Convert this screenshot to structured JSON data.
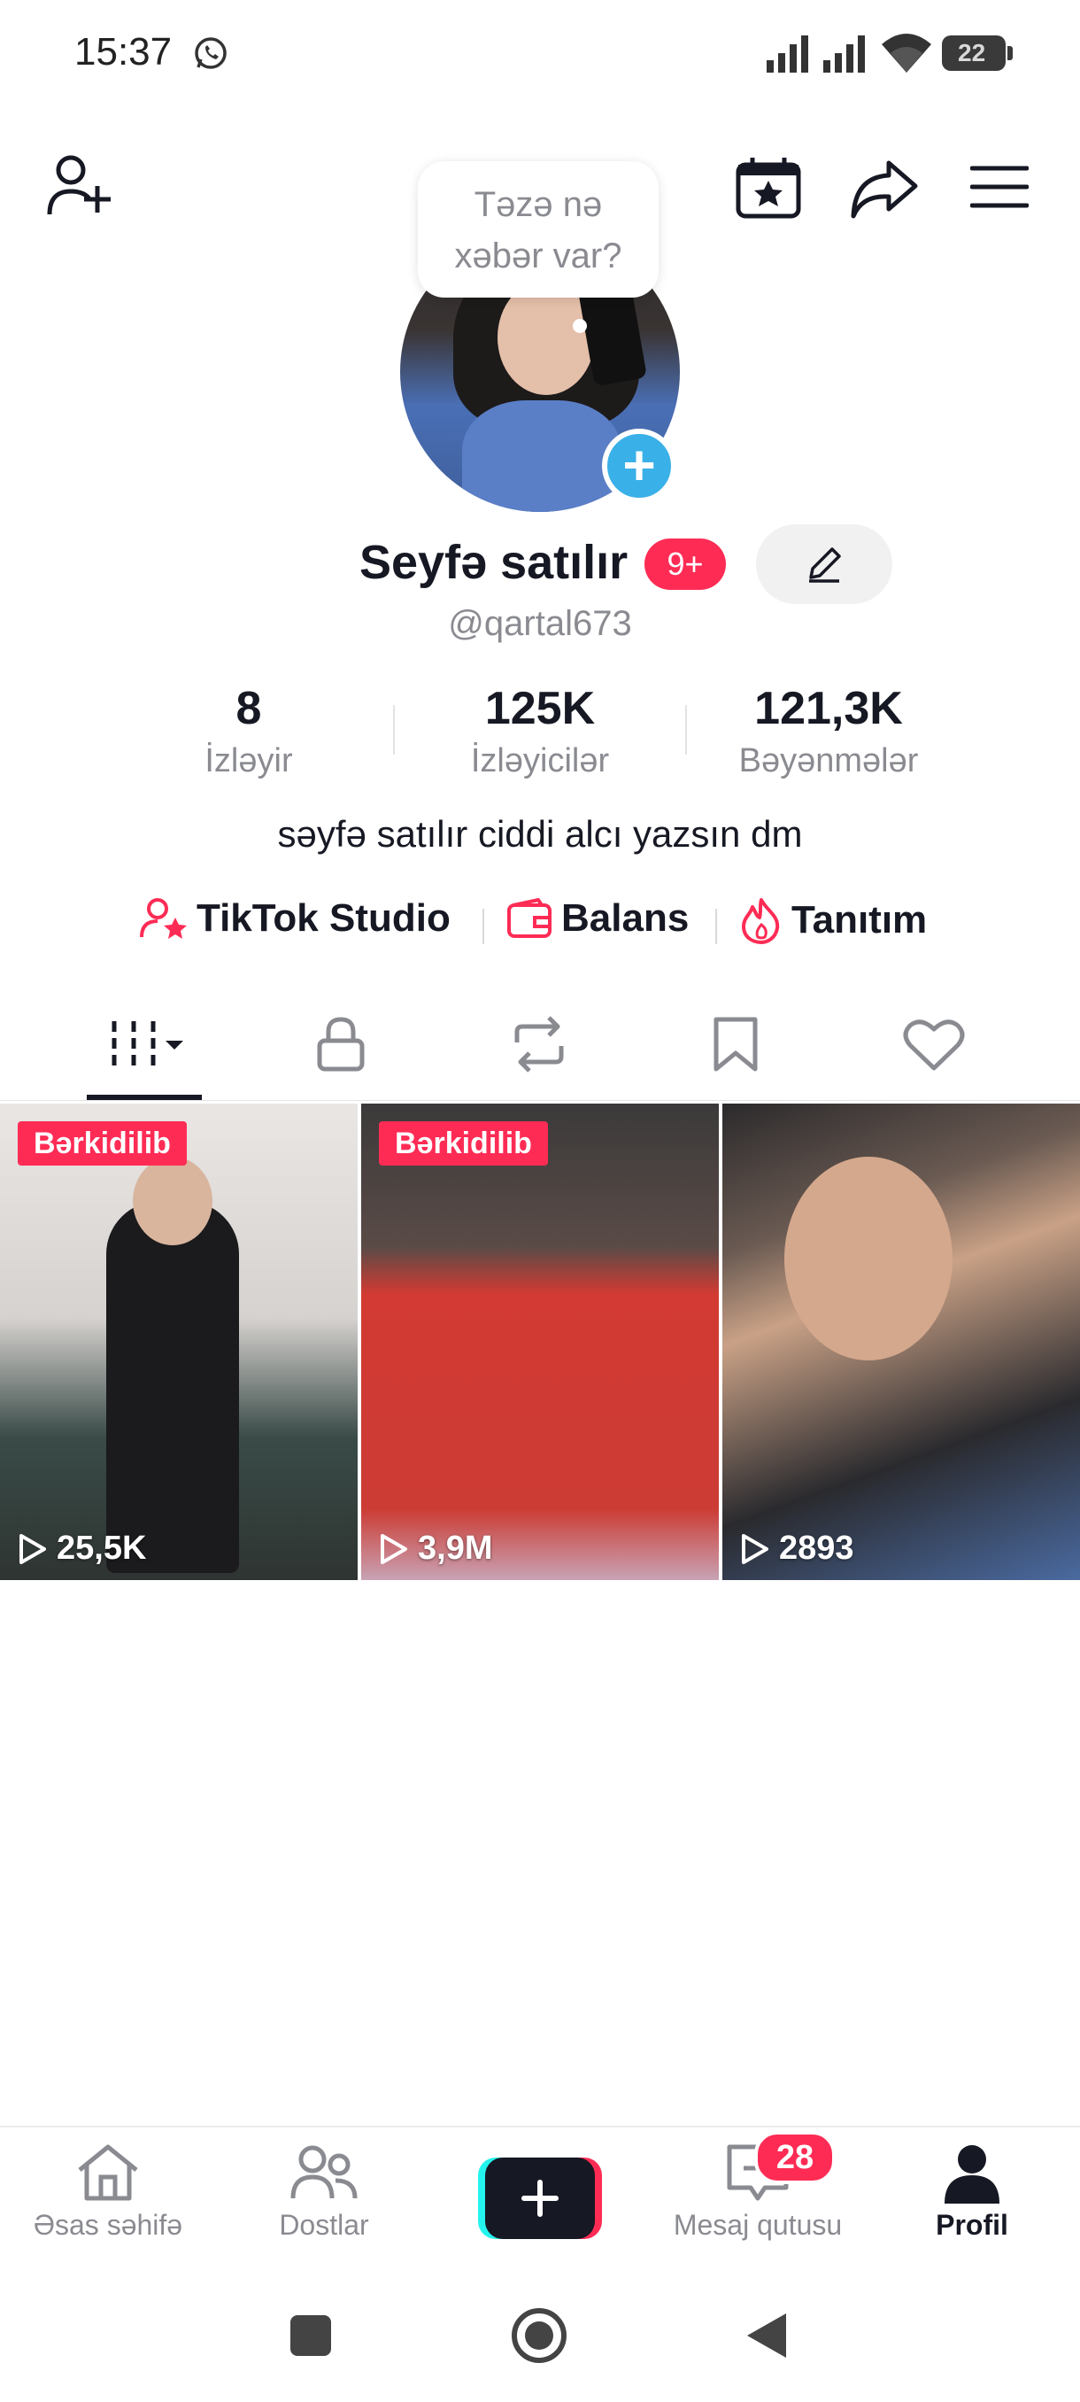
{
  "status_bar": {
    "time": "15:37",
    "battery": "22"
  },
  "bubble": {
    "line1": "Təzə nə",
    "line2": "xəbər var?"
  },
  "profile": {
    "name": "Seyfə satılır",
    "badge": "9+",
    "username": "@qartal673",
    "bio": "səyfə satılır ciddi alcı yazsın dm"
  },
  "stats": [
    {
      "value": "8",
      "label": "İzləyir"
    },
    {
      "value": "125K",
      "label": "İzləyicilər"
    },
    {
      "value": "121,3K",
      "label": "Bəyənmələr"
    }
  ],
  "tools": [
    {
      "label": "TikTok Studio",
      "icon": "person-star-icon"
    },
    {
      "label": "Balans",
      "icon": "wallet-icon"
    },
    {
      "label": "Tanıtım",
      "icon": "flame-icon"
    }
  ],
  "videos": [
    {
      "pinned_label": "Bərkidilib",
      "views": "25,5K"
    },
    {
      "pinned_label": "Bərkidilib",
      "views": "3,9M"
    },
    {
      "pinned_label": "",
      "views": "2893"
    }
  ],
  "bottom_nav": [
    {
      "label": "Əsas səhifə",
      "icon": "home-icon"
    },
    {
      "label": "Dostlar",
      "icon": "friends-icon"
    },
    {
      "label": "",
      "icon": "create-icon"
    },
    {
      "label": "Mesaj qutusu",
      "icon": "inbox-icon",
      "badge": "28"
    },
    {
      "label": "Profil",
      "icon": "profile-icon"
    }
  ],
  "colors": {
    "accent": "#fe2c55",
    "blue": "#3ab0e8",
    "text": "#161823",
    "muted": "#8a8b91"
  }
}
